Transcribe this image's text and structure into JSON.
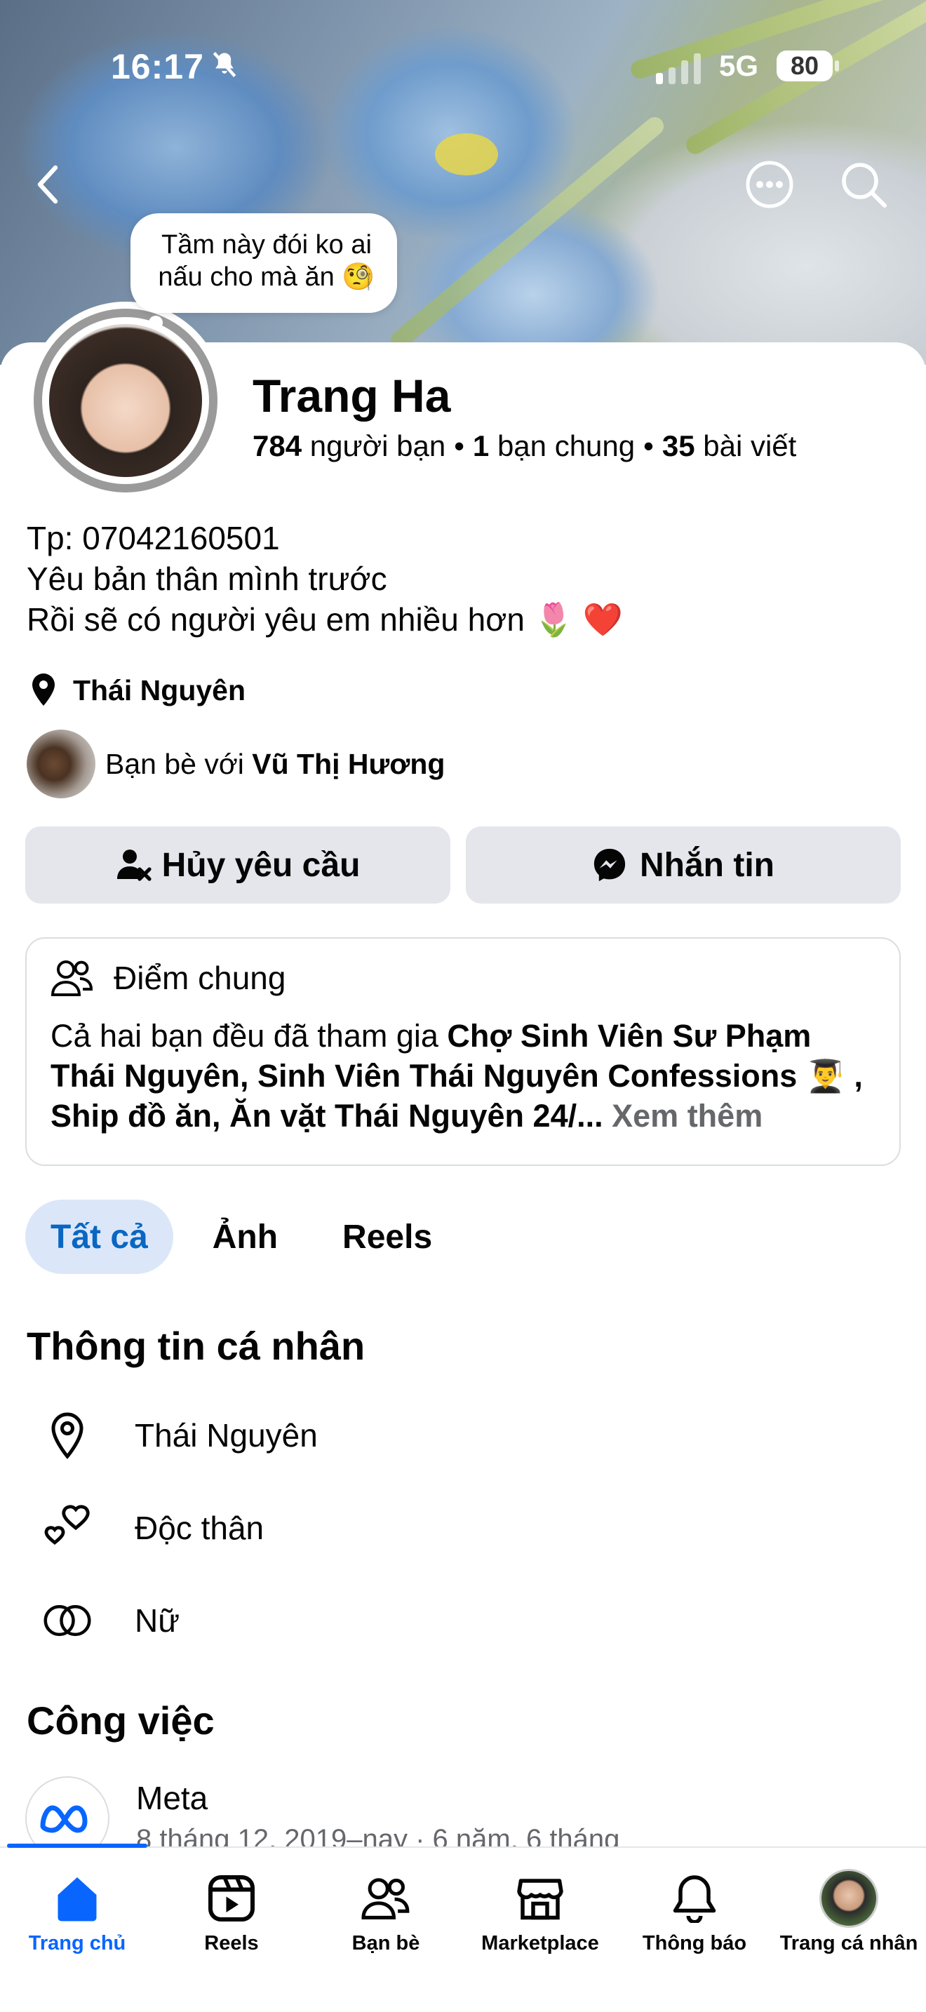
{
  "status": {
    "time": "16:17",
    "network": "5G",
    "battery": "80"
  },
  "profile": {
    "note": "Tầm này đói ko ai nấu cho mà ăn 🧐",
    "name": "Trang Ha",
    "friends_count": "784",
    "friends_label": "người bạn",
    "mutual_count": "1",
    "mutual_label": "bạn chung",
    "posts_count": "35",
    "posts_label": "bài viết",
    "bio": [
      "Tp: 07042160501",
      "Yêu bản thân mình trước",
      "Rồi sẽ có người yêu em nhiều hơn 🌷 ❤️"
    ],
    "location": "Thái Nguyên",
    "friend_with_prefix": "Bạn bè với",
    "friend_with_name": "Vũ Thị Hương"
  },
  "actions": {
    "cancel_request": "Hủy yêu cầu",
    "message": "Nhắn tin"
  },
  "common": {
    "title": "Điểm chung",
    "prefix": "Cả hai bạn đều đã tham gia",
    "groups": "Chợ Sinh Viên Sư Phạm Thái Nguyên, Sinh Viên Thái Nguyên Confessions 👨‍🎓 , Ship đồ ăn, Ăn vặt Thái Nguyên 24/...",
    "see_more": "Xem thêm"
  },
  "tabs": [
    "Tất cả",
    "Ảnh",
    "Reels"
  ],
  "personal_info": {
    "title": "Thông tin cá nhân",
    "items": [
      "Thái Nguyên",
      "Độc thân",
      "Nữ"
    ]
  },
  "work": {
    "title": "Công việc",
    "company": "Meta",
    "period": "8 tháng 12, 2019–nay · 6 năm, 6 tháng"
  },
  "nav": [
    "Trang chủ",
    "Reels",
    "Bạn bè",
    "Marketplace",
    "Thông báo",
    "Trang cá nhân"
  ],
  "colors": {
    "accent": "#0866ff",
    "tab_active_bg": "#dbe7f9",
    "button_bg": "#e4e6eb"
  }
}
